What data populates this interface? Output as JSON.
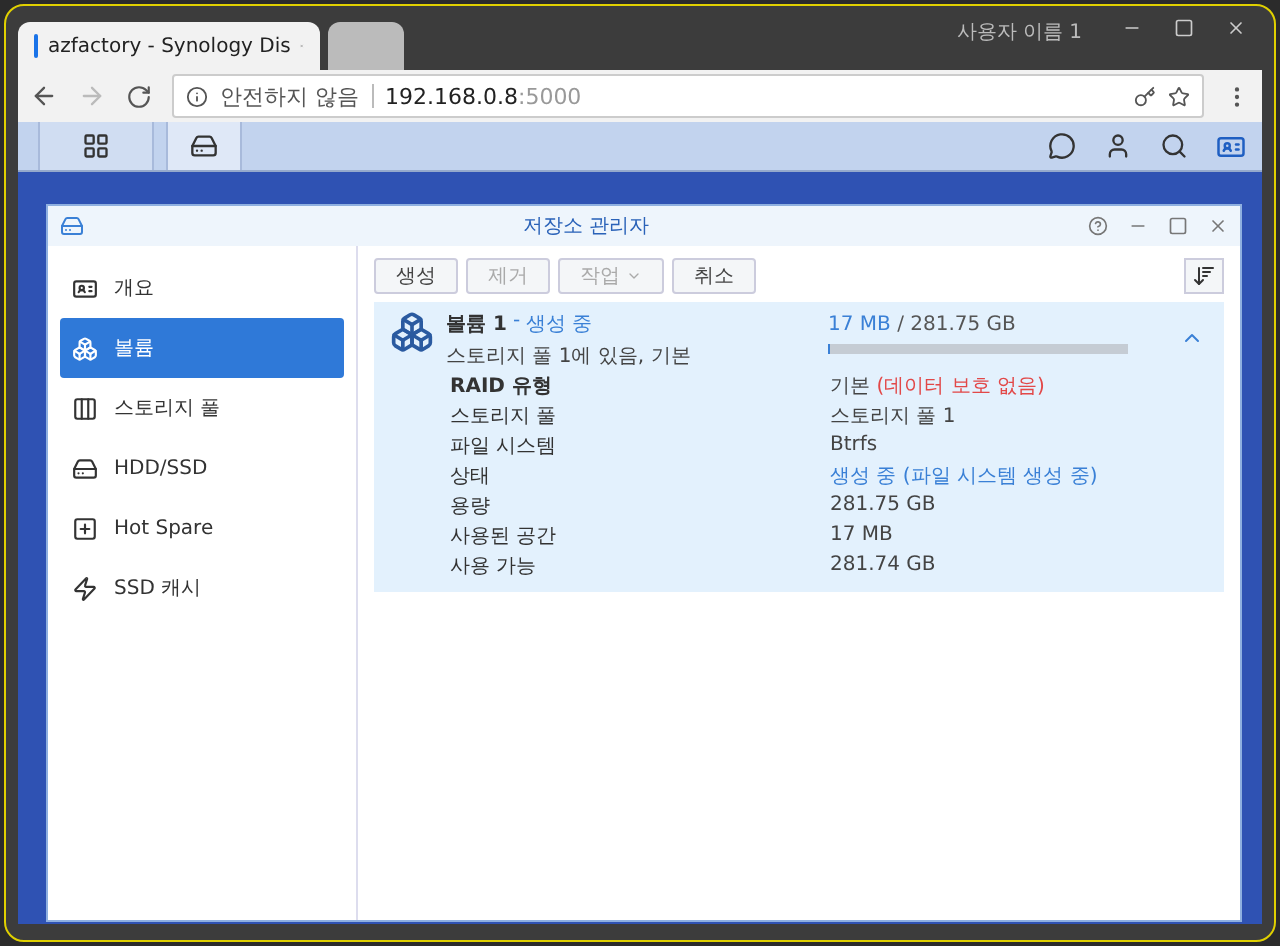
{
  "browser": {
    "tabs": [
      {
        "label": "azfactory - Synology Dis",
        "selected": true
      },
      {
        "selected": false
      }
    ],
    "user": "사용자 이름 1",
    "security": "안전하지 않음",
    "url_host": "192.168.0.8",
    "url_port": ":5000"
  },
  "taskbar": {
    "apps": [
      {
        "kind": "grid",
        "selected": false
      },
      {
        "kind": "storage",
        "selected": true
      }
    ]
  },
  "window": {
    "title": "저장소 관리자",
    "sidebar": [
      {
        "label": "개요",
        "kind": "overview",
        "selected": false
      },
      {
        "label": "볼륨",
        "kind": "volume",
        "selected": true
      },
      {
        "label": "스토리지 풀",
        "kind": "pool",
        "selected": false
      },
      {
        "label": "HDD/SSD",
        "kind": "disk",
        "selected": false
      },
      {
        "label": "Hot Spare",
        "kind": "spare",
        "selected": false
      },
      {
        "label": "SSD 캐시",
        "kind": "cache",
        "selected": false
      }
    ],
    "toolbar": [
      {
        "label": "생성",
        "disabled": false,
        "dropdown": false
      },
      {
        "label": "제거",
        "disabled": true,
        "dropdown": false
      },
      {
        "label": "작업",
        "disabled": true,
        "dropdown": true
      },
      {
        "label": "취소",
        "disabled": false,
        "dropdown": false
      }
    ],
    "volume": {
      "name": "볼륨 1",
      "separator": "-",
      "status": "생성 중",
      "subtitle": "스토리지 풀 1에 있음, 기본",
      "used": "17 MB",
      "total": "/ 281.75 GB",
      "level": 0.0001,
      "expanded": true,
      "rows": [
        {
          "label": "RAID 유형",
          "bold": true,
          "value": "기본",
          "note": "(데이터 보호 없음)",
          "kind": "warning"
        },
        {
          "label": "스토리지 풀",
          "bold": false,
          "value": "스토리지 풀 1",
          "kind": "plain"
        },
        {
          "label": "파일 시스템",
          "bold": false,
          "value": "Btrfs",
          "kind": "plain"
        },
        {
          "label": "상태",
          "bold": false,
          "value": "생성 중",
          "note": "(파일 시스템 생성 중)",
          "kind": "info"
        },
        {
          "label": "용량",
          "bold": false,
          "value": "281.75 GB",
          "kind": "plain"
        },
        {
          "label": "사용된 공간",
          "bold": false,
          "value": "17 MB",
          "kind": "plain"
        },
        {
          "label": "사용 가능",
          "bold": false,
          "value": "281.74 GB",
          "kind": "plain"
        }
      ]
    }
  }
}
